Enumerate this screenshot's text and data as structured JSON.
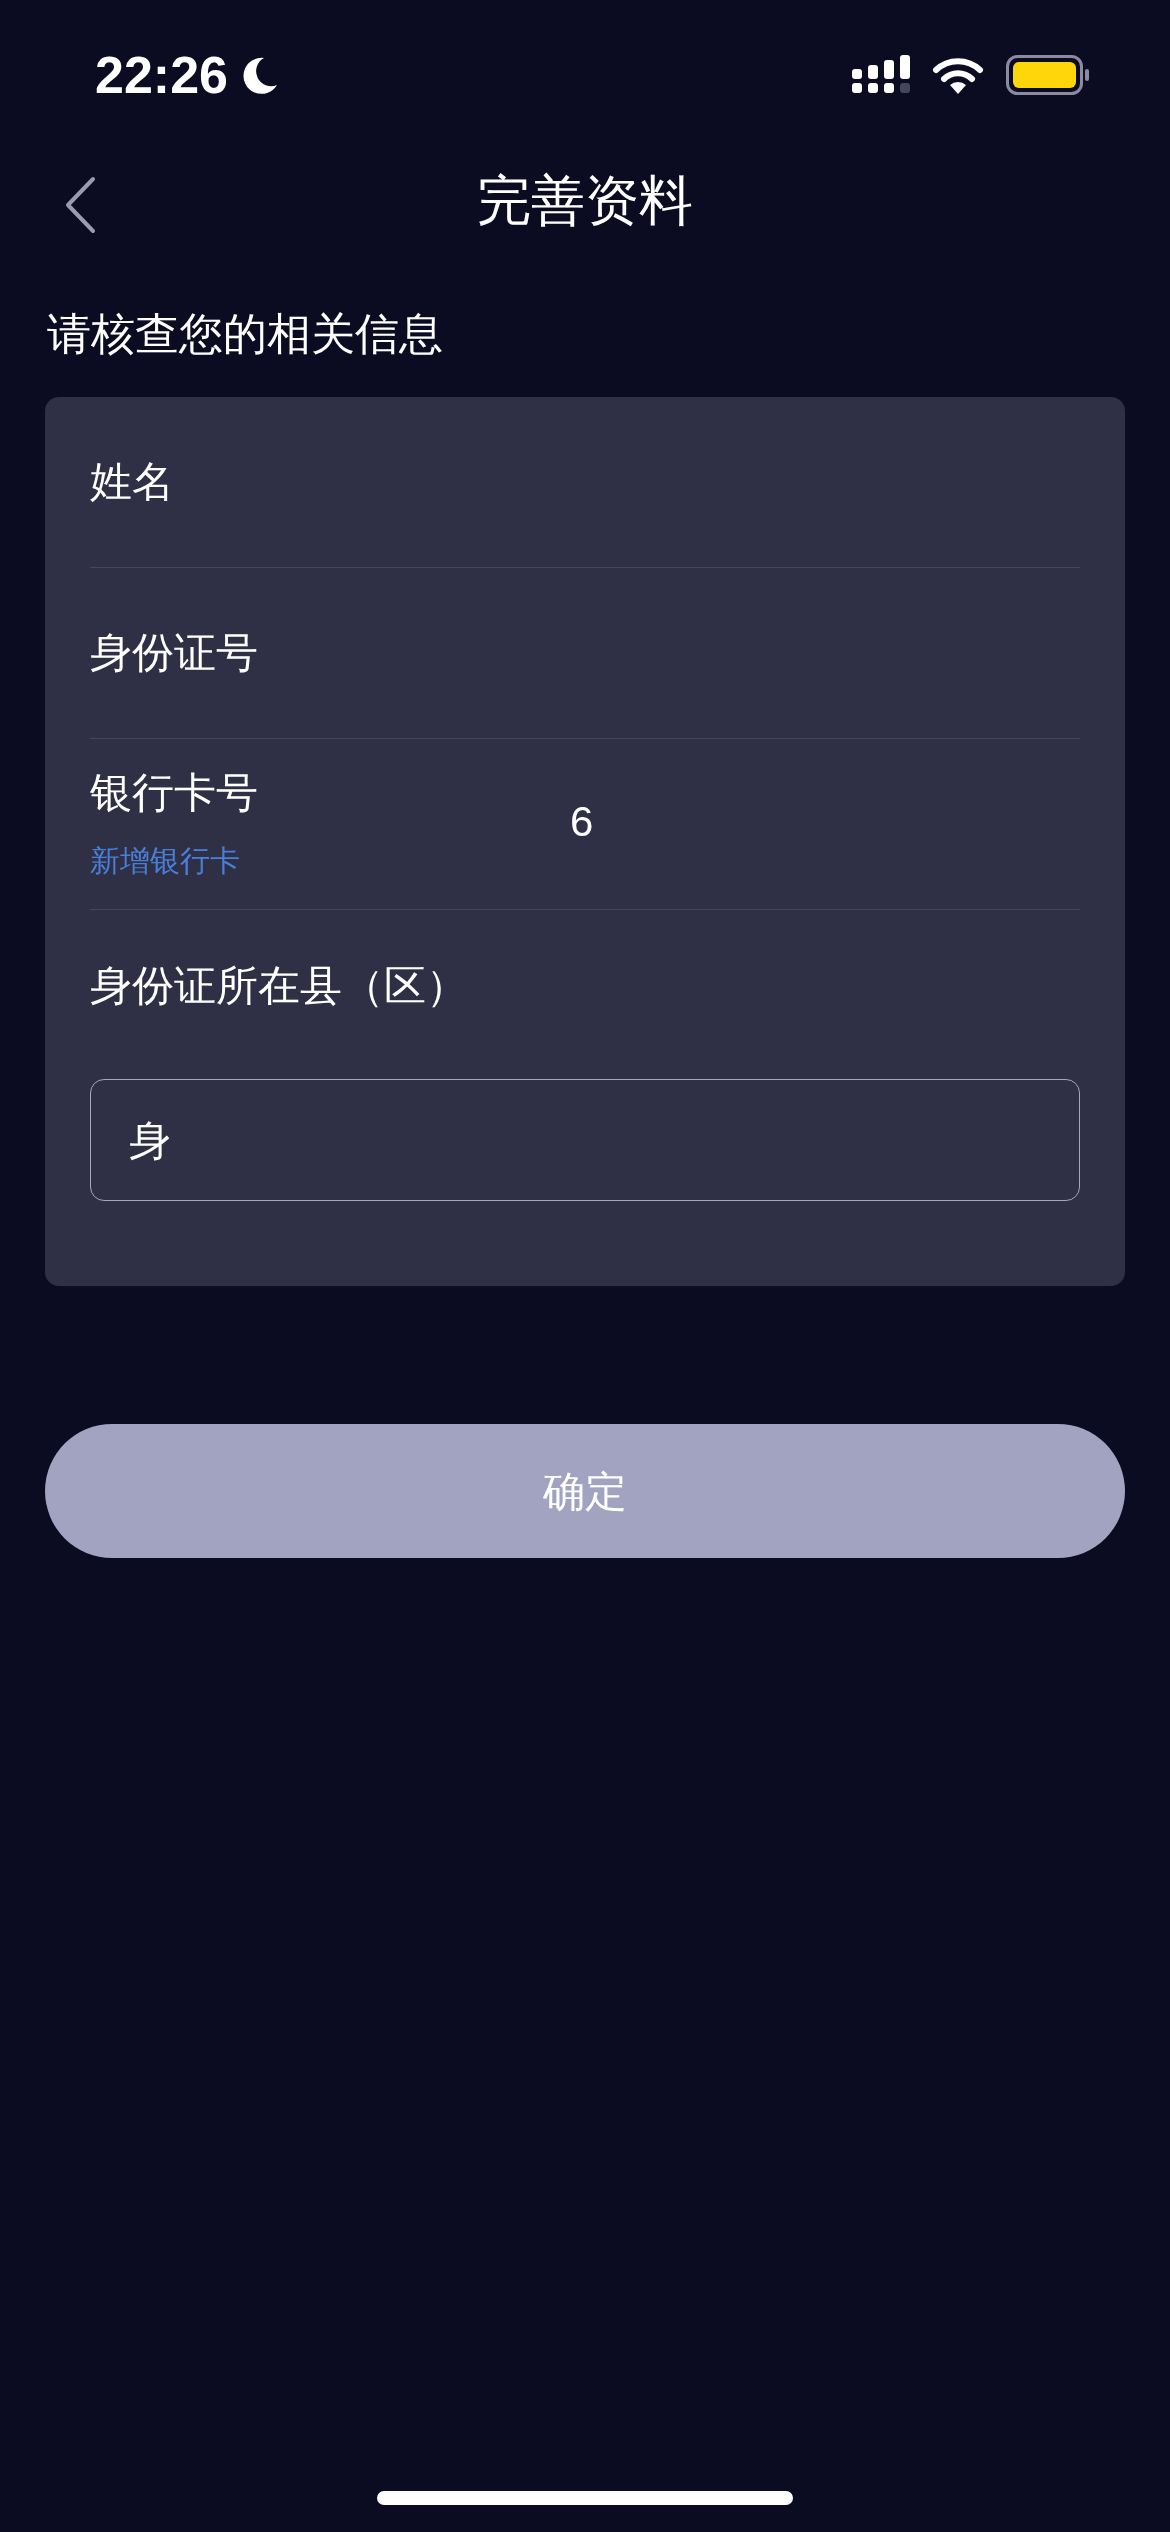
{
  "status_bar": {
    "time": "22:26"
  },
  "nav": {
    "title": "完善资料"
  },
  "subtitle": "请核查您的相关信息",
  "form": {
    "rows": [
      {
        "kind": "field",
        "label": "姓名"
      },
      {
        "kind": "field",
        "label": "身份证号"
      },
      {
        "kind": "field",
        "label": "银行卡号",
        "link": "新增银行卡",
        "value": "6"
      },
      {
        "kind": "input",
        "label": "身份证所在县（区）",
        "value": "身"
      }
    ]
  },
  "confirm_button": "确定"
}
